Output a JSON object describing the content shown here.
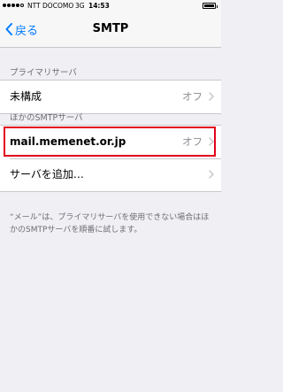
{
  "status_bar": {
    "carrier": "NTT DOCOMO",
    "network": "3G",
    "time": "14:53"
  },
  "nav": {
    "back_label": "戻る",
    "title": "SMTP"
  },
  "primary": {
    "header": "プライマリサーバ",
    "row": {
      "label": "未構成",
      "value": "オフ"
    }
  },
  "other": {
    "header": "ほかのSMTPサーバ",
    "rows": [
      {
        "label": "mail.memenet.or.jp",
        "value": "オフ"
      },
      {
        "label": "サーバを追加…"
      }
    ]
  },
  "footer_text": "“メール”は、プライマリサーバを使用できない場合はほかのSMTPサーバを順番に試します。",
  "colors": {
    "accent": "#007aff",
    "highlight": "#e2001a",
    "background": "#efeff4"
  },
  "icons": {
    "back": "chevron-left-icon",
    "disclosure": "chevron-right-icon"
  }
}
